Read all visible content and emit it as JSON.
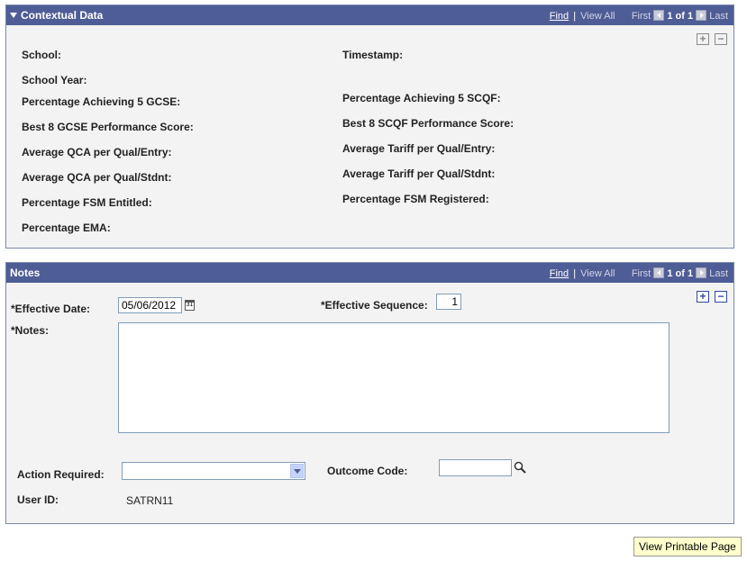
{
  "nav": {
    "find": "Find",
    "separator": "|",
    "view_all": "View All",
    "first": "First",
    "page": "1 of 1",
    "last": "Last"
  },
  "contextual": {
    "title": "Contextual Data",
    "left": [
      {
        "label": "School:"
      },
      {
        "label": "School Year:"
      },
      {
        "label": "Percentage Achieving 5 GCSE:"
      },
      {
        "label": "Best 8 GCSE Performance Score:"
      },
      {
        "label": "Average QCA per Qual/Entry:"
      },
      {
        "label": "Average QCA per Qual/Stdnt:"
      },
      {
        "label": "Percentage FSM Entitled:"
      },
      {
        "label": "Percentage EMA:"
      }
    ],
    "right": [
      {
        "label": "Timestamp:"
      },
      {
        "label": "Percentage Achieving 5 SCQF:"
      },
      {
        "label": "Best 8 SCQF Performance Score:"
      },
      {
        "label": "Average Tariff per Qual/Entry:"
      },
      {
        "label": "Average Tariff per Qual/Stdnt:"
      },
      {
        "label": "Percentage FSM Registered:"
      }
    ],
    "add": "+",
    "remove": "−"
  },
  "notes": {
    "title": "Notes",
    "effective_date_label": "*Effective Date:",
    "effective_date_value": "05/06/2012",
    "calendar_text": "31",
    "effective_seq_label": "*Effective Sequence:",
    "effective_seq_value": "1",
    "notes_label": "*Notes:",
    "notes_value": "",
    "action_label": "Action Required:",
    "action_value": "",
    "outcome_label": "Outcome Code:",
    "outcome_value": "",
    "userid_label": "User ID:",
    "userid_value": "SATRN11",
    "add": "+",
    "remove": "−"
  },
  "footer": {
    "printable_button": "View Printable Page"
  },
  "colors": {
    "header_bg": "#4f5d96",
    "panel_bg": "#f3f3f3",
    "button_bg": "#ffffcc"
  }
}
